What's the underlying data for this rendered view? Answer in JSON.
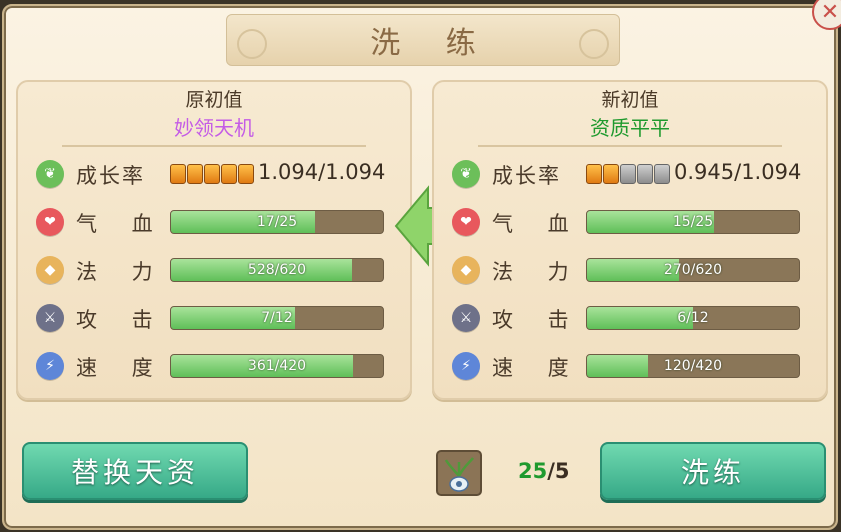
{
  "title": "洗 练",
  "left_panel": {
    "header": "原初值",
    "quality": "妙领天机",
    "growth": {
      "label": "成长率",
      "value": "1.094/1.094",
      "pips_filled": 5,
      "pips_total": 5
    },
    "stats": [
      {
        "label": "气 血",
        "icon": "heart-icon",
        "text": "17/25",
        "current": 17,
        "max": 25
      },
      {
        "label": "法 力",
        "icon": "mana-icon",
        "text": "528/620",
        "current": 528,
        "max": 620
      },
      {
        "label": "攻 击",
        "icon": "sword-icon",
        "text": "7/12",
        "current": 7,
        "max": 12
      },
      {
        "label": "速 度",
        "icon": "lightning-icon",
        "text": "361/420",
        "current": 361,
        "max": 420
      }
    ]
  },
  "right_panel": {
    "header": "新初值",
    "quality": "资质平平",
    "growth": {
      "label": "成长率",
      "value": "0.945/1.094",
      "pips_filled": 2,
      "pips_total": 5
    },
    "stats": [
      {
        "label": "气 血",
        "icon": "heart-icon",
        "text": "15/25",
        "current": 15,
        "max": 25
      },
      {
        "label": "法 力",
        "icon": "mana-icon",
        "text": "270/620",
        "current": 270,
        "max": 620
      },
      {
        "label": "攻 击",
        "icon": "sword-icon",
        "text": "6/12",
        "current": 6,
        "max": 12
      },
      {
        "label": "速 度",
        "icon": "lightning-icon",
        "text": "120/420",
        "current": 120,
        "max": 420
      }
    ]
  },
  "buttons": {
    "swap": "替换天资",
    "train": "洗练"
  },
  "item": {
    "icon": "potted-plant-icon",
    "owned": "25",
    "cost": "/5"
  },
  "colors": {
    "button": "#45b792",
    "fill": "#6cc562",
    "quality_purple": "#c45ce6",
    "quality_green": "#1f9a2e"
  }
}
